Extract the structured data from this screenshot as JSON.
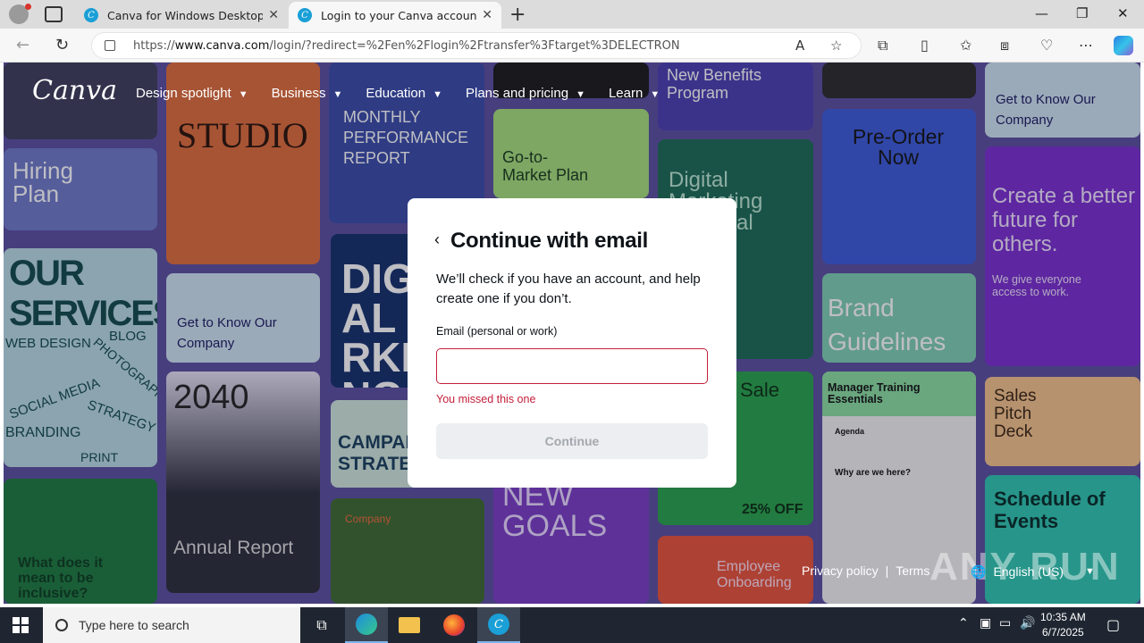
{
  "browser": {
    "tabs": [
      {
        "title": "Canva for Windows Desktop App",
        "active": false
      },
      {
        "title": "Login to your Canva account",
        "active": true
      }
    ],
    "url_prefix": "https://",
    "url_domain": "www.canva.com",
    "url_rest": "/login/?redirect=%2Fen%2Flogin%2Ftransfer%3Ftarget%3DELECTRON"
  },
  "site": {
    "logo": "Canva",
    "nav": [
      "Design spotlight",
      "Business",
      "Education",
      "Plans and pricing",
      "Learn"
    ]
  },
  "tiles": {
    "studio": "STUDIO",
    "hiring_plan": "Hiring Plan",
    "monthly_report": "MONTHLY PERFORMANCE REPORT",
    "go_to_market": "Go-to-Market Plan",
    "benefits": "New Benefits Program",
    "digital_marketing": "Digital Marketing Proposal",
    "pre_order": "Pre-Order Now",
    "get_to_know_1": "Get to Know Our Company",
    "get_to_know_2": "Get to Know Our Company",
    "create_future": "Create a better future for others.",
    "create_future_sub": "We give everyone access to work.",
    "our_services": "OUR SERVICES",
    "services_tags": [
      "WEB DESIGN",
      "BLOG",
      "PHOTOGRAPHY",
      "SOCIAL MEDIA",
      "STRATEGY",
      "BRANDING",
      "PRINT"
    ],
    "year": "2040",
    "annual_report": "Annual Report",
    "brand_guidelines": "Brand Guidelines",
    "manager_training": "Manager Training Essentials",
    "agenda": "Agenda",
    "why_here": "Why are we here?",
    "sales_pitch": "Sales Pitch Deck",
    "schedule": "Schedule of Events",
    "new_goals": "NEW GOALS",
    "sale": "Sale",
    "sale_off": "25% OFF",
    "employee_onboarding": "Employee Onboarding",
    "what_does": "What does it mean to be inclusive?",
    "campaign": "CAMPAIGN STRATEGY",
    "digital_market": "DIGITAL MARKETING",
    "company": "Company"
  },
  "modal": {
    "title": "Continue with email",
    "description": "We’ll check if you have an account, and help create one if you don’t.",
    "email_label": "Email (personal or work)",
    "email_value": "",
    "error": "You missed this one",
    "continue_label": "Continue"
  },
  "footer": {
    "privacy": "Privacy policy",
    "terms": "Terms",
    "language": "English (US)",
    "watermark": "ANY RUN"
  },
  "taskbar": {
    "search_placeholder": "Type here to search",
    "time": "10:35 AM",
    "date": "6/7/2025"
  }
}
